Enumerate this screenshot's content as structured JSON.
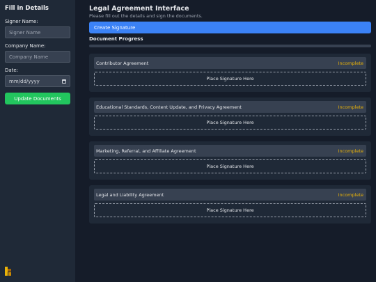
{
  "sidebar": {
    "title": "Fill in Details",
    "signer_label": "Signer Name:",
    "signer_placeholder": "Signer Name",
    "company_label": "Company Name:",
    "company_placeholder": "Company Name",
    "date_label": "Date:",
    "date_placeholder": "mm/dd/yyyy",
    "update_button": "Update Documents"
  },
  "main": {
    "title": "Legal Agreement Interface",
    "subtitle": "Please fill out the details and sign the documents.",
    "create_button": "Create Signature",
    "progress_label": "Document Progress",
    "progress_value": 0,
    "documents": [
      {
        "name": "Contributor Agreement",
        "status": "Incomplete",
        "signature_label": "Place Signature Here"
      },
      {
        "name": "Educational Standards, Content Update, and Privacy Agreement",
        "status": "Incomplete",
        "signature_label": "Place Signature Here"
      },
      {
        "name": "Marketing, Referral, and Affiliate Agreement",
        "status": "Incomplete",
        "signature_label": "Place Signature Here"
      },
      {
        "name": "Legal and Liability Agreement",
        "status": "Incomplete",
        "signature_label": "Place Signature Here"
      }
    ]
  },
  "colors": {
    "accent": "#3b82f6",
    "success": "#22c55e",
    "warning": "#eab308"
  }
}
